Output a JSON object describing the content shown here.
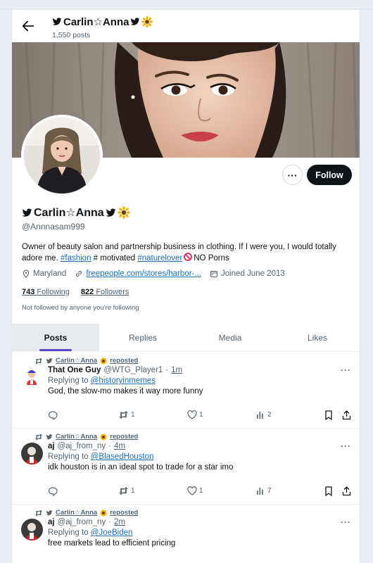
{
  "header": {
    "display_name": "Carlin☆Anna",
    "post_count": "1,550 posts"
  },
  "profile": {
    "display_name": "Carlin☆Anna",
    "handle": "@Annnasam999",
    "bio_part1": "Owner of beauty salon and partnership business in clothing. If I were you, I would totally adore me. ",
    "bio_tag1": "#fashion",
    "bio_part2": " # motivated ",
    "bio_tag2": "#naturelover",
    "bio_part3": "NO Porns",
    "location": "Maryland",
    "website": "freepeople.com/stores/harbor-...",
    "joined": "Joined June 2013",
    "following_count": "743",
    "following_label": "Following",
    "followers_count": "822",
    "followers_label": "Followers",
    "not_followed": "Not followed by anyone you're following",
    "follow_label": "Follow",
    "more_label": "···"
  },
  "tabs": [
    {
      "label": "Posts"
    },
    {
      "label": "Replies"
    },
    {
      "label": "Media"
    },
    {
      "label": "Likes"
    }
  ],
  "posts": [
    {
      "repost_name": "Carlin☆Anna",
      "repost_label": "reposted",
      "author": "That One Guy",
      "handle": "@WTG_Player1",
      "sep": "·",
      "time": "1m",
      "replying_prefix": "Replying to",
      "replying_to": "@historyinmemes",
      "text": "God, the slow-mo makes it way more funny",
      "retweets": "1",
      "likes": "1",
      "views": "2"
    },
    {
      "repost_name": "Carlin☆Anna",
      "repost_label": "reposted",
      "author": "aj",
      "handle": "@aj_from_ny",
      "sep": "·",
      "time": "4m",
      "replying_prefix": "Replying to",
      "replying_to": "@BlasedHouston",
      "text": "idk houston is in an ideal spot to trade for a star imo",
      "retweets": "1",
      "likes": "1",
      "views": "7"
    },
    {
      "repost_name": "Carlin☆Anna",
      "repost_label": "reposted",
      "author": "aj",
      "handle": "@aj_from_ny",
      "sep": "·",
      "time": "2m",
      "replying_prefix": "Replying to",
      "replying_to": "@JoeBiden",
      "text": "free markets lead to efficient pricing"
    }
  ],
  "colors": {
    "accent": "#1d6fb8",
    "tab_indicator": "#5a48c8",
    "follow_bg": "#0f1419"
  },
  "icons": [
    "back-arrow-icon",
    "twitter-bird-icon",
    "sunflower-icon",
    "location-pin-icon",
    "link-icon",
    "calendar-icon",
    "no-entry-icon",
    "repost-icon",
    "reply-icon",
    "retweet-icon",
    "like-icon",
    "views-icon",
    "bookmark-icon",
    "share-icon",
    "more-icon"
  ]
}
